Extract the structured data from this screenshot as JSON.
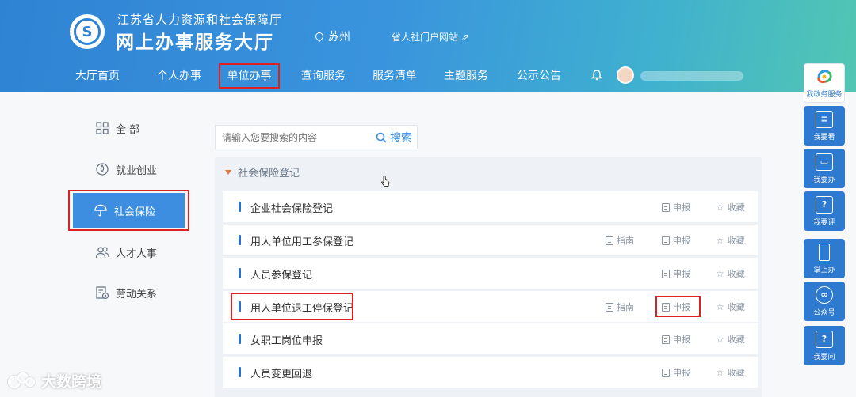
{
  "header": {
    "org_name": "江苏省人力资源和社会保障厅",
    "hall_name": "网上办事服务大厅",
    "location": "苏州",
    "portal_link": "省人社门户网站 ⇗"
  },
  "nav": {
    "items": [
      {
        "label": "大厅首页"
      },
      {
        "label": "个人办事"
      },
      {
        "label": "单位办事"
      },
      {
        "label": "查询服务"
      },
      {
        "label": "服务清单"
      },
      {
        "label": "主题服务"
      },
      {
        "label": "公示公告"
      }
    ],
    "active_index": 2
  },
  "sidebar": {
    "items": [
      {
        "label": "全 部",
        "icon": "grid-icon"
      },
      {
        "label": "就业创业",
        "icon": "drop-icon"
      },
      {
        "label": "社会保险",
        "icon": "umbrella-icon"
      },
      {
        "label": "人才人事",
        "icon": "people-icon"
      },
      {
        "label": "劳动关系",
        "icon": "doc-gear-icon"
      }
    ],
    "active_index": 2
  },
  "search": {
    "placeholder": "请输入您要搜索的内容",
    "button_label": "搜索"
  },
  "category": {
    "label": "社会保险登记"
  },
  "rows": [
    {
      "title": "企业社会保险登记",
      "guide": "",
      "apply": "申报",
      "favorite": "收藏"
    },
    {
      "title": "用人单位用工参保登记",
      "guide": "指南",
      "apply": "申报",
      "favorite": "收藏"
    },
    {
      "title": "人员参保登记",
      "guide": "",
      "apply": "申报",
      "favorite": "收藏"
    },
    {
      "title": "用人单位退工停保登记",
      "guide": "指南",
      "apply": "申报",
      "favorite": "收藏"
    },
    {
      "title": "女职工岗位申报",
      "guide": "",
      "apply": "申报",
      "favorite": "收藏"
    },
    {
      "title": "人员变更回退",
      "guide": "",
      "apply": "申报",
      "favorite": "收藏"
    }
  ],
  "right_bar": [
    {
      "label": "我政务服务"
    },
    {
      "label": "我要看"
    },
    {
      "label": "我要办"
    },
    {
      "label": "我要评"
    },
    {
      "label": "掌上办"
    },
    {
      "label": "公众号"
    },
    {
      "label": "我要问"
    }
  ],
  "watermark": "大数跨境",
  "colors": {
    "header_start": "#2f83d3",
    "header_end": "#52c6b2",
    "active_blue": "#3d8ee0",
    "highlight_red": "#e02020",
    "category_orange": "#e0763a"
  }
}
